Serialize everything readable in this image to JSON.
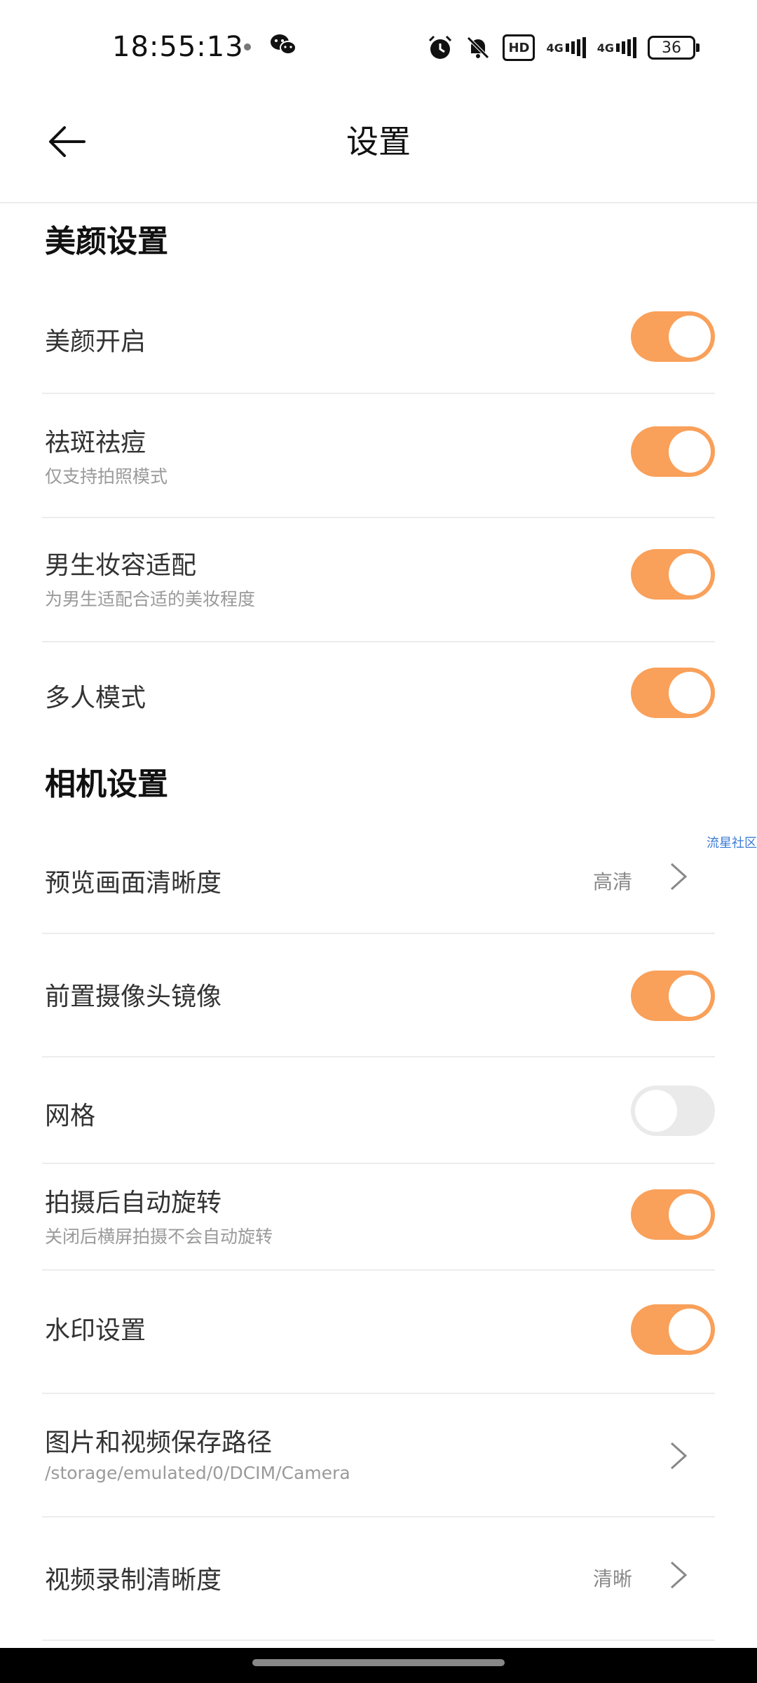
{
  "status_bar": {
    "time": "18:55:13",
    "net1": "4G",
    "net2": "4G",
    "hd": "HD",
    "battery": "36"
  },
  "header": {
    "title": "设置"
  },
  "beauty_section": {
    "title": "美颜设置",
    "items": [
      {
        "label": "美颜开启",
        "sub": "",
        "on": true
      },
      {
        "label": "祛斑祛痘",
        "sub": "仅支持拍照模式",
        "on": true
      },
      {
        "label": "男生妆容适配",
        "sub": "为男生适配合适的美妆程度",
        "on": true
      },
      {
        "label": "多人模式",
        "sub": "",
        "on": true
      }
    ]
  },
  "camera_section": {
    "title": "相机设置",
    "preview": {
      "label": "预览画面清晰度",
      "value": "高清"
    },
    "front_mirror": {
      "label": "前置摄像头镜像",
      "on": true
    },
    "grid": {
      "label": "网格",
      "on": false
    },
    "auto_rotate": {
      "label": "拍摄后自动旋转",
      "sub": "关闭后横屏拍摄不会自动旋转",
      "on": true
    },
    "watermark_setting": {
      "label": "水印设置",
      "on": true
    },
    "save_path": {
      "label": "图片和视频保存路径",
      "sub": "/storage/emulated/0/DCIM/Camera"
    },
    "video_quality": {
      "label": "视频录制清晰度",
      "value": "清晰"
    }
  },
  "watermark_text": "流星社区",
  "colors": {
    "accent": "#f9a05a",
    "toggle_off": "#eaeaea"
  },
  "icons": [
    "wechat-icon",
    "alarm-icon",
    "bell-mute-icon",
    "back-arrow-icon",
    "chevron-right-icon"
  ]
}
